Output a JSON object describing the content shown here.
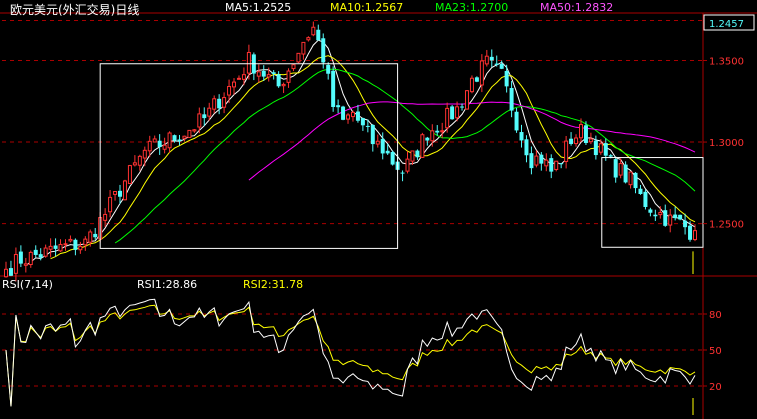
{
  "header": {
    "title": "欧元美元(外汇交易)日线",
    "indicators": [
      {
        "label": "MA5:1.2525",
        "color": "#ffffff"
      },
      {
        "label": "MA10:1.2567",
        "color": "#ffff00"
      },
      {
        "label": "MA23:1.2700",
        "color": "#00ff00"
      },
      {
        "label": "MA50:1.2832",
        "color": "#ff00ff"
      }
    ]
  },
  "rsi_header": {
    "name": "RSI(7,14)",
    "rsi1": "RSI1:28.86",
    "rsi2": "RSI2:31.78"
  },
  "colors": {
    "up": "#ff3232",
    "down": "#54fcfc",
    "grid": "#aa0000",
    "axis": "#aa0000",
    "label": "#ff3232",
    "title": "#ffffff",
    "last_price_bg": "#000000",
    "box": "#ffffff"
  },
  "chart_data": [
    {
      "type": "candlestick",
      "title": "欧元美元(外汇交易)日线",
      "y_ticks": [
        "1.2500",
        "1.3000",
        "1.3500"
      ],
      "y_tick_values": [
        1.25,
        1.3,
        1.35
      ],
      "ylim": [
        1.2185,
        1.3785
      ],
      "last_price_label": "1.2457",
      "last_price": 1.2457,
      "candle_count": 140,
      "path_anchors": [
        [
          0,
          1.222
        ],
        [
          3,
          1.228
        ],
        [
          8,
          1.232
        ],
        [
          12,
          1.236
        ],
        [
          16,
          1.238
        ],
        [
          20,
          1.256
        ],
        [
          24,
          1.276
        ],
        [
          28,
          1.294
        ],
        [
          32,
          1.3
        ],
        [
          36,
          1.306
        ],
        [
          40,
          1.314
        ],
        [
          44,
          1.33
        ],
        [
          47,
          1.34
        ],
        [
          49,
          1.35
        ],
        [
          52,
          1.342
        ],
        [
          55,
          1.334
        ],
        [
          58,
          1.35
        ],
        [
          60,
          1.362
        ],
        [
          62,
          1.37
        ],
        [
          64,
          1.352
        ],
        [
          66,
          1.322
        ],
        [
          68,
          1.312
        ],
        [
          70,
          1.318
        ],
        [
          72,
          1.308
        ],
        [
          74,
          1.3
        ],
        [
          76,
          1.296
        ],
        [
          78,
          1.288
        ],
        [
          80,
          1.282
        ],
        [
          82,
          1.29
        ],
        [
          85,
          1.306
        ],
        [
          88,
          1.312
        ],
        [
          91,
          1.32
        ],
        [
          94,
          1.338
        ],
        [
          97,
          1.348
        ],
        [
          100,
          1.34
        ],
        [
          102,
          1.322
        ],
        [
          104,
          1.304
        ],
        [
          106,
          1.29
        ],
        [
          108,
          1.29
        ],
        [
          110,
          1.282
        ],
        [
          112,
          1.29
        ],
        [
          114,
          1.302
        ],
        [
          116,
          1.306
        ],
        [
          118,
          1.302
        ],
        [
          120,
          1.294
        ],
        [
          122,
          1.286
        ],
        [
          124,
          1.282
        ],
        [
          126,
          1.276
        ],
        [
          128,
          1.266
        ],
        [
          130,
          1.26
        ],
        [
          132,
          1.256
        ],
        [
          134,
          1.252
        ],
        [
          136,
          1.25
        ],
        [
          138,
          1.2457
        ]
      ],
      "ma5_last": 1.2525,
      "ma10_last": 1.2567,
      "ma23_last": 1.27,
      "ma50_last": 1.2832,
      "annotation_boxes": 2
    },
    {
      "type": "line",
      "title": "RSI(7,14)",
      "y_ticks": [
        "20",
        "50",
        "80"
      ],
      "y_tick_values": [
        20,
        50,
        80
      ],
      "ylim": [
        0,
        100
      ],
      "series": [
        {
          "name": "RSI1",
          "color": "#ffffff",
          "last": 28.86
        },
        {
          "name": "RSI2",
          "color": "#ffff00",
          "last": 31.78
        }
      ]
    }
  ]
}
